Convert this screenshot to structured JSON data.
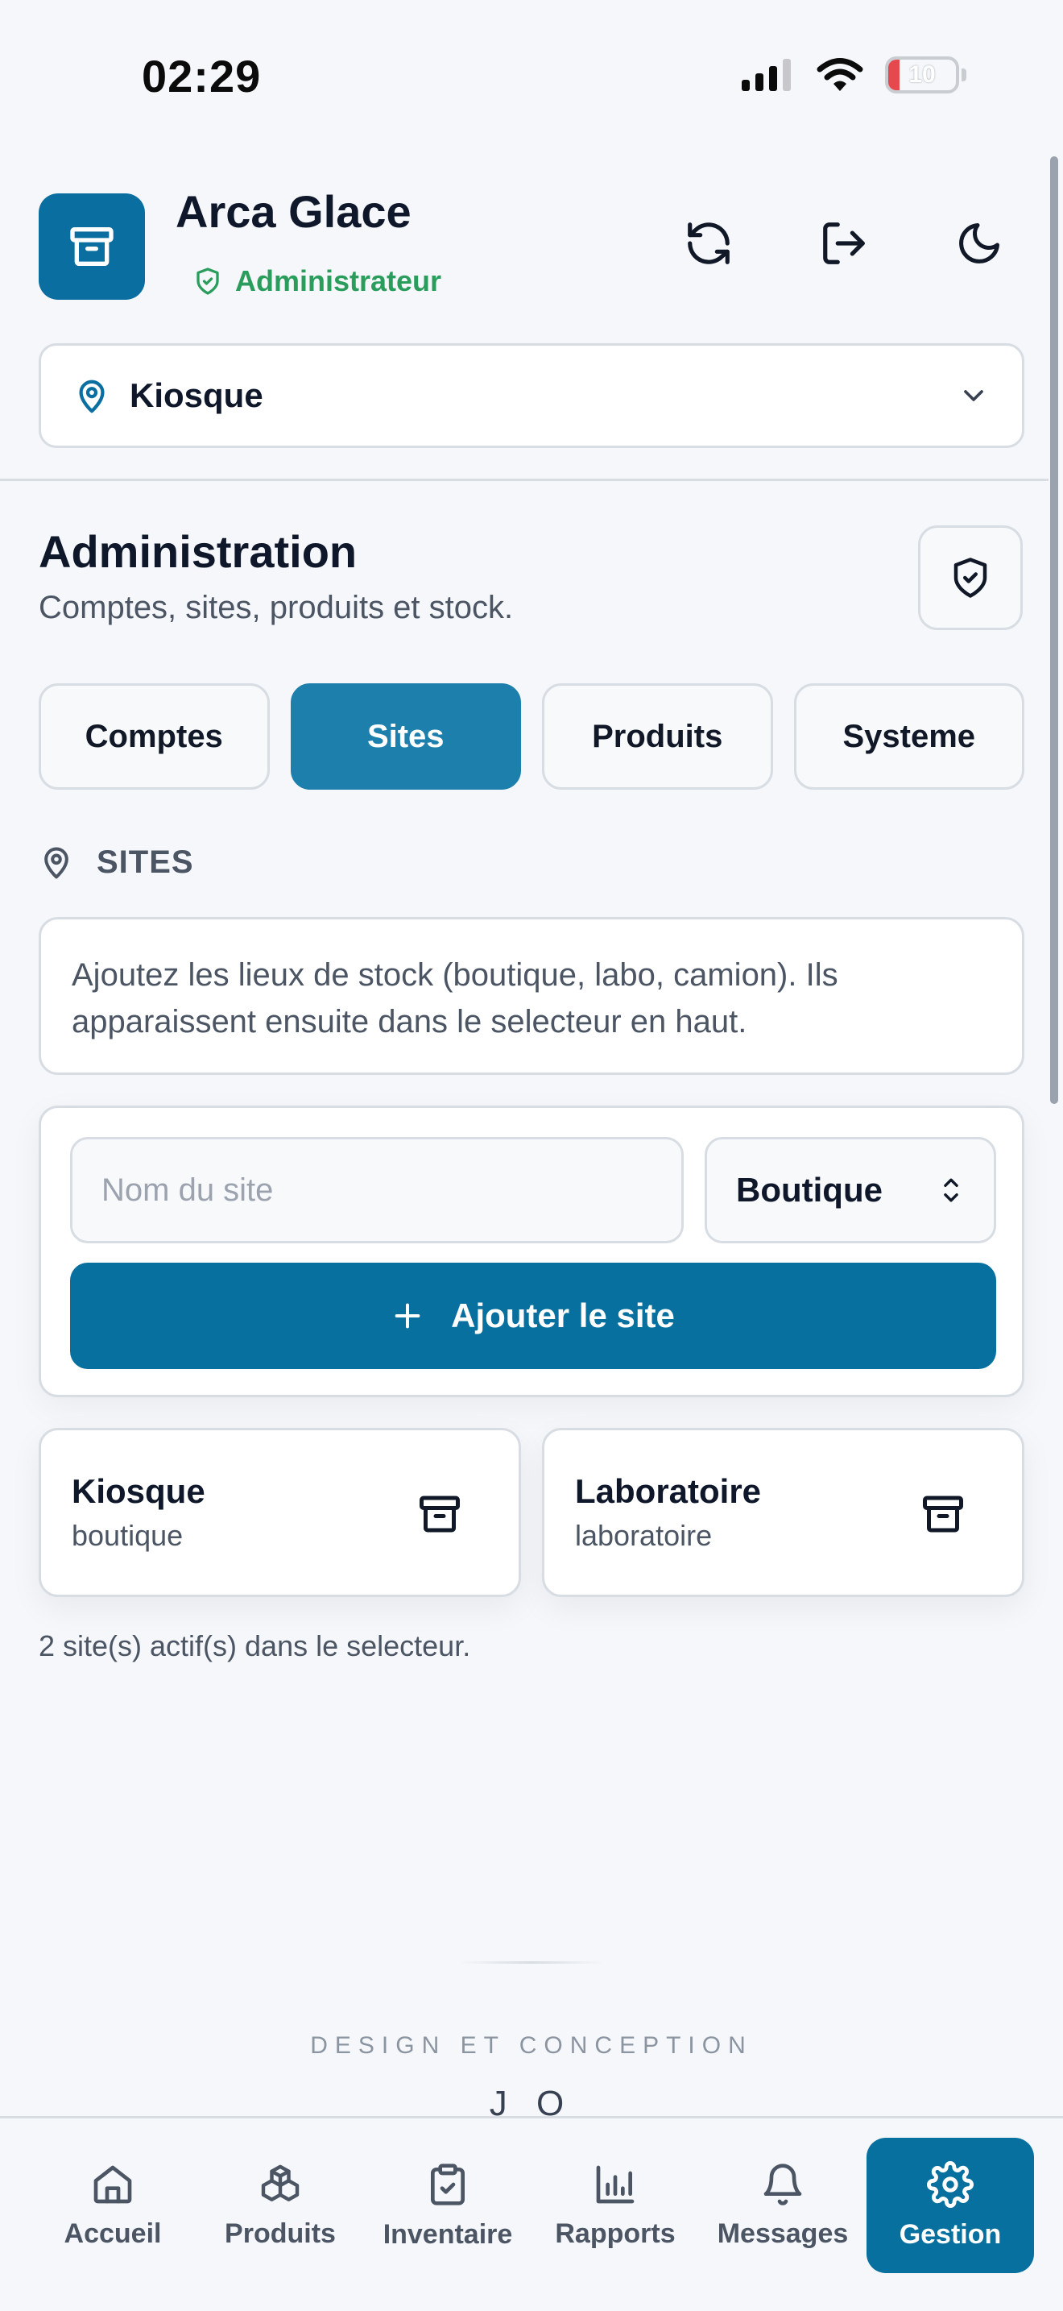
{
  "status": {
    "time": "02:29",
    "battery": "10"
  },
  "header": {
    "app_title": "Arca Glace",
    "role": "Administrateur",
    "site_selector": "Kiosque"
  },
  "section": {
    "title": "Administration",
    "subtitle": "Comptes, sites, produits et stock."
  },
  "tabs": [
    {
      "label": "Comptes",
      "active": false
    },
    {
      "label": "Sites",
      "active": true
    },
    {
      "label": "Produits",
      "active": false
    },
    {
      "label": "Systeme",
      "active": false
    }
  ],
  "sites_panel": {
    "label": "SITES",
    "info": "Ajoutez les lieux de stock (boutique, labo, camion). Ils apparaissent ensuite dans le selecteur en haut.",
    "name_placeholder": "Nom du site",
    "name_value": "",
    "type_selected": "Boutique",
    "add_label": "Ajouter le site",
    "sites": [
      {
        "name": "Kiosque",
        "type": "boutique"
      },
      {
        "name": "Laboratoire",
        "type": "laboratoire"
      }
    ],
    "active_count": "2 site(s) actif(s) dans le selecteur."
  },
  "footer": {
    "credit": "DESIGN ET CONCEPTION",
    "author": "J O"
  },
  "nav": [
    {
      "label": "Accueil",
      "icon": "home-icon",
      "active": false
    },
    {
      "label": "Produits",
      "icon": "boxes-icon",
      "active": false
    },
    {
      "label": "Inventaire",
      "icon": "clipboard-check-icon",
      "active": false
    },
    {
      "label": "Rapports",
      "icon": "bar-chart-icon",
      "active": false
    },
    {
      "label": "Messages",
      "icon": "bell-icon",
      "active": false
    },
    {
      "label": "Gestion",
      "icon": "gear-icon",
      "active": true
    }
  ],
  "colors": {
    "primary": "#07709f",
    "tab_active": "#1d7fac",
    "success": "#2a9d5c",
    "battery_low": "#e5484d"
  }
}
